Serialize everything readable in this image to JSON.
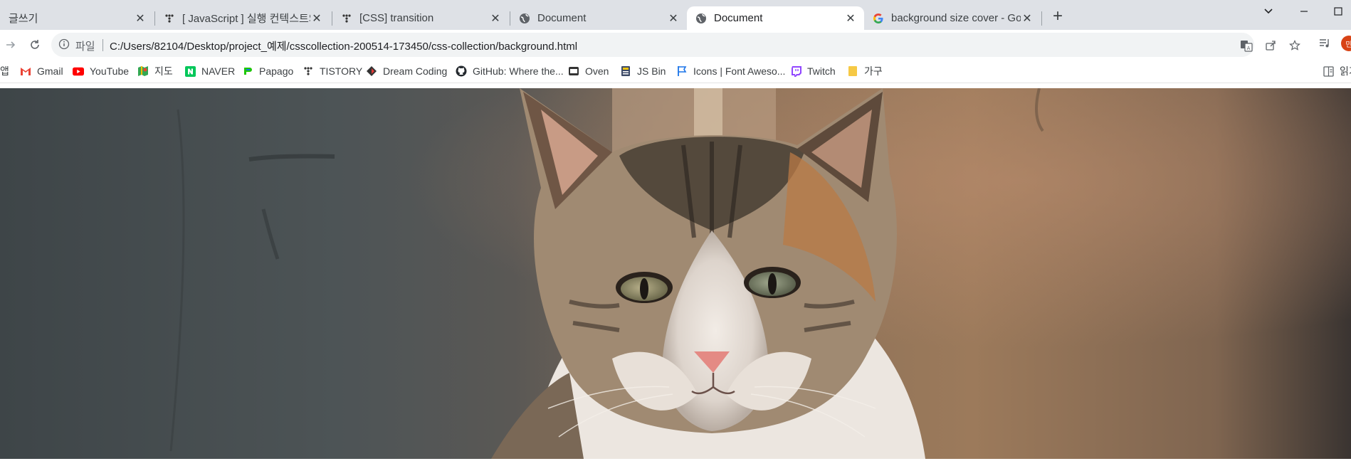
{
  "tabs": [
    {
      "title": "글쓰기",
      "favicon": "none",
      "active": false
    },
    {
      "title": "[ JavaScript ] 실행 컨텍스트와 스",
      "favicon": "tistory-icon",
      "active": false
    },
    {
      "title": "[CSS] transition",
      "favicon": "tistory-icon",
      "active": false
    },
    {
      "title": "Document",
      "favicon": "globe-icon",
      "active": false
    },
    {
      "title": "Document",
      "favicon": "globe-icon",
      "active": true
    },
    {
      "title": "background size cover - Google",
      "favicon": "google-icon",
      "active": false
    }
  ],
  "address_bar": {
    "scheme_label": "파일",
    "url": "C:/Users/82104/Desktop/project_예제/csscollection-200514-173450/css-collection/background.html"
  },
  "bookmarks": [
    {
      "label": "앱",
      "icon": "apps-icon"
    },
    {
      "label": "Gmail",
      "icon": "gmail-icon"
    },
    {
      "label": "YouTube",
      "icon": "youtube-icon"
    },
    {
      "label": "지도",
      "icon": "maps-icon"
    },
    {
      "label": "NAVER",
      "icon": "naver-icon"
    },
    {
      "label": "Papago",
      "icon": "papago-icon"
    },
    {
      "label": "TISTORY",
      "icon": "tistory-icon"
    },
    {
      "label": "Dream Coding",
      "icon": "dream-coding-icon"
    },
    {
      "label": "GitHub: Where the...",
      "icon": "github-icon"
    },
    {
      "label": "Oven",
      "icon": "oven-icon"
    },
    {
      "label": "JS Bin",
      "icon": "jsbin-icon"
    },
    {
      "label": "Icons | Font Aweso...",
      "icon": "font-awesome-icon"
    },
    {
      "label": "Twitch",
      "icon": "twitch-icon"
    },
    {
      "label": "가구",
      "icon": "folder-icon"
    }
  ],
  "reading_list": {
    "label": "읽기",
    "icon": "reading-list-icon"
  },
  "profile": {
    "initials": "민"
  },
  "content": {
    "image": "photo of a calico cat looking at the camera in front of a weathered wall at sunset",
    "background_size": "cover"
  },
  "colors": {
    "tabstrip": "#dee1e6",
    "omnibox": "#f1f3f4",
    "profile": "#d84315"
  }
}
